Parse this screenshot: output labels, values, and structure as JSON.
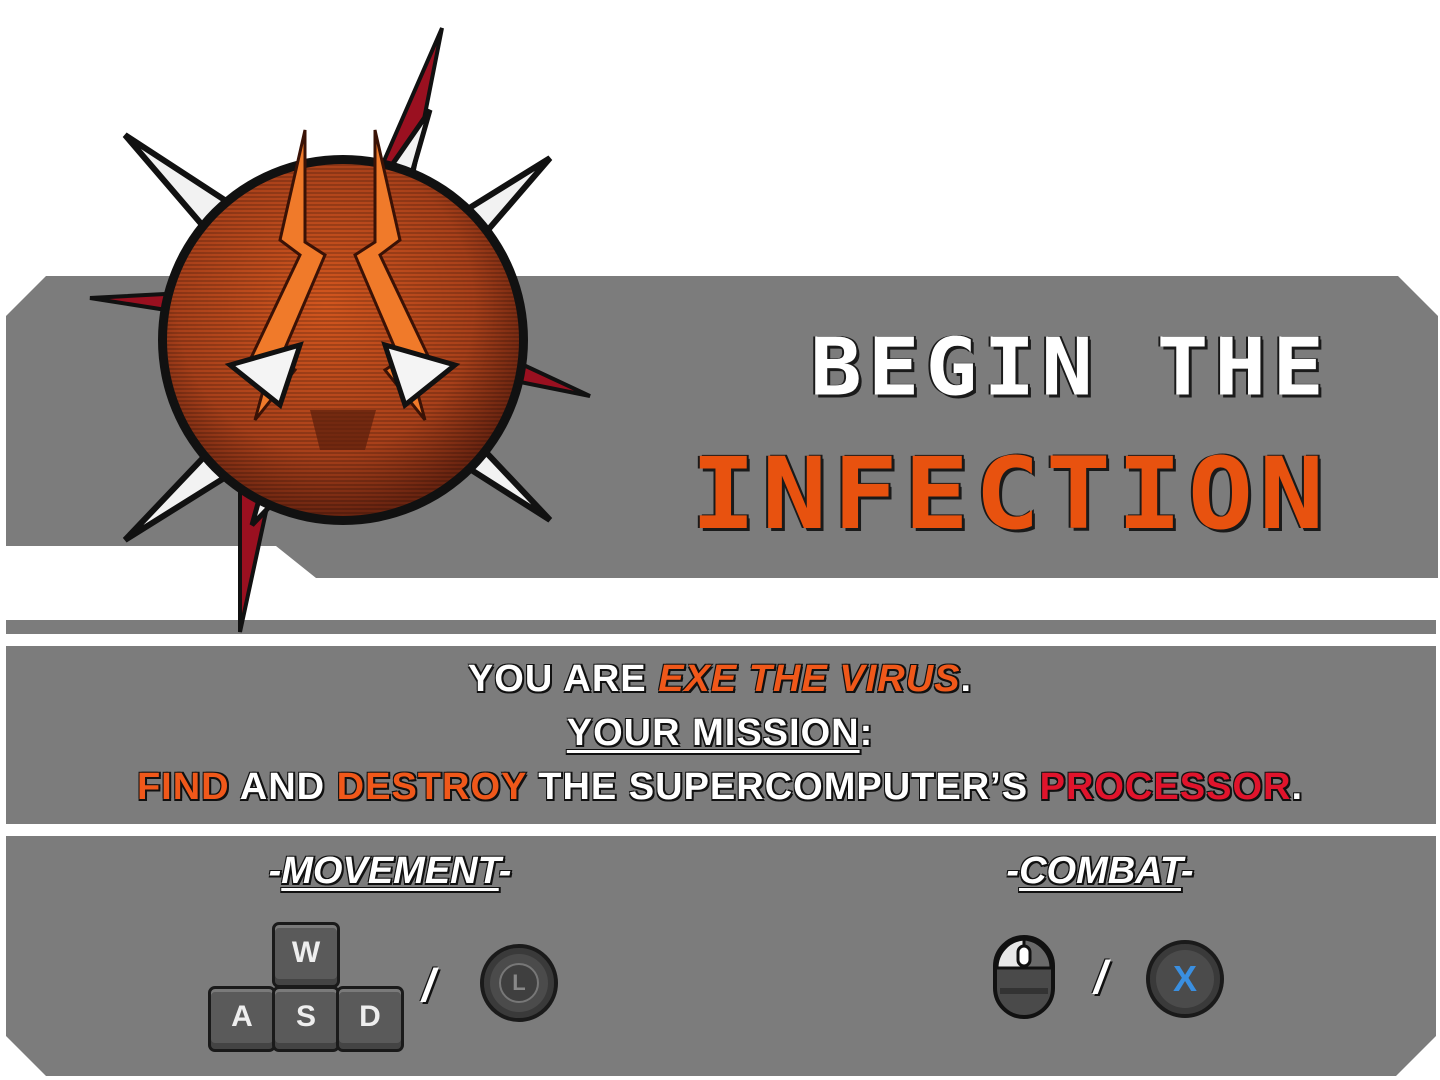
{
  "title": {
    "line1": "BEGIN THE",
    "line2": "INFECTION"
  },
  "mission": {
    "line1": [
      {
        "text": "YOU ARE ",
        "style": "normal"
      },
      {
        "text": "EXE THE VIRUS",
        "style": "orange-italic"
      },
      {
        "text": ".",
        "style": "normal"
      }
    ],
    "line2": [
      {
        "text": "YOUR MISSION",
        "style": "underline"
      },
      {
        "text": ":",
        "style": "normal"
      }
    ],
    "line3": [
      {
        "text": "FIND",
        "style": "orange"
      },
      {
        "text": " AND ",
        "style": "normal"
      },
      {
        "text": "DESTROY",
        "style": "orange"
      },
      {
        "text": " THE SUPERCOMPUTER’S ",
        "style": "normal"
      },
      {
        "text": "PROCESSOR",
        "style": "red"
      },
      {
        "text": ".",
        "style": "normal"
      }
    ]
  },
  "controls": {
    "movement": {
      "heading": "MOVEMENT",
      "keys": [
        "W",
        "A",
        "S",
        "D"
      ],
      "separator": "/",
      "gamepad_label": "L",
      "gamepad_icon": "left-stick-icon"
    },
    "combat": {
      "heading": "COMBAT",
      "mouse_icon": "mouse-left-click-icon",
      "separator": "/",
      "gamepad_label": "X",
      "gamepad_icon": "x-button-icon"
    }
  },
  "colors": {
    "panel": "#7c7c7c",
    "accent_orange": "#e8520f",
    "accent_red": "#e0142c",
    "gamepad_x": "#3a8fe0",
    "emblem_orb": "#b8451a"
  }
}
